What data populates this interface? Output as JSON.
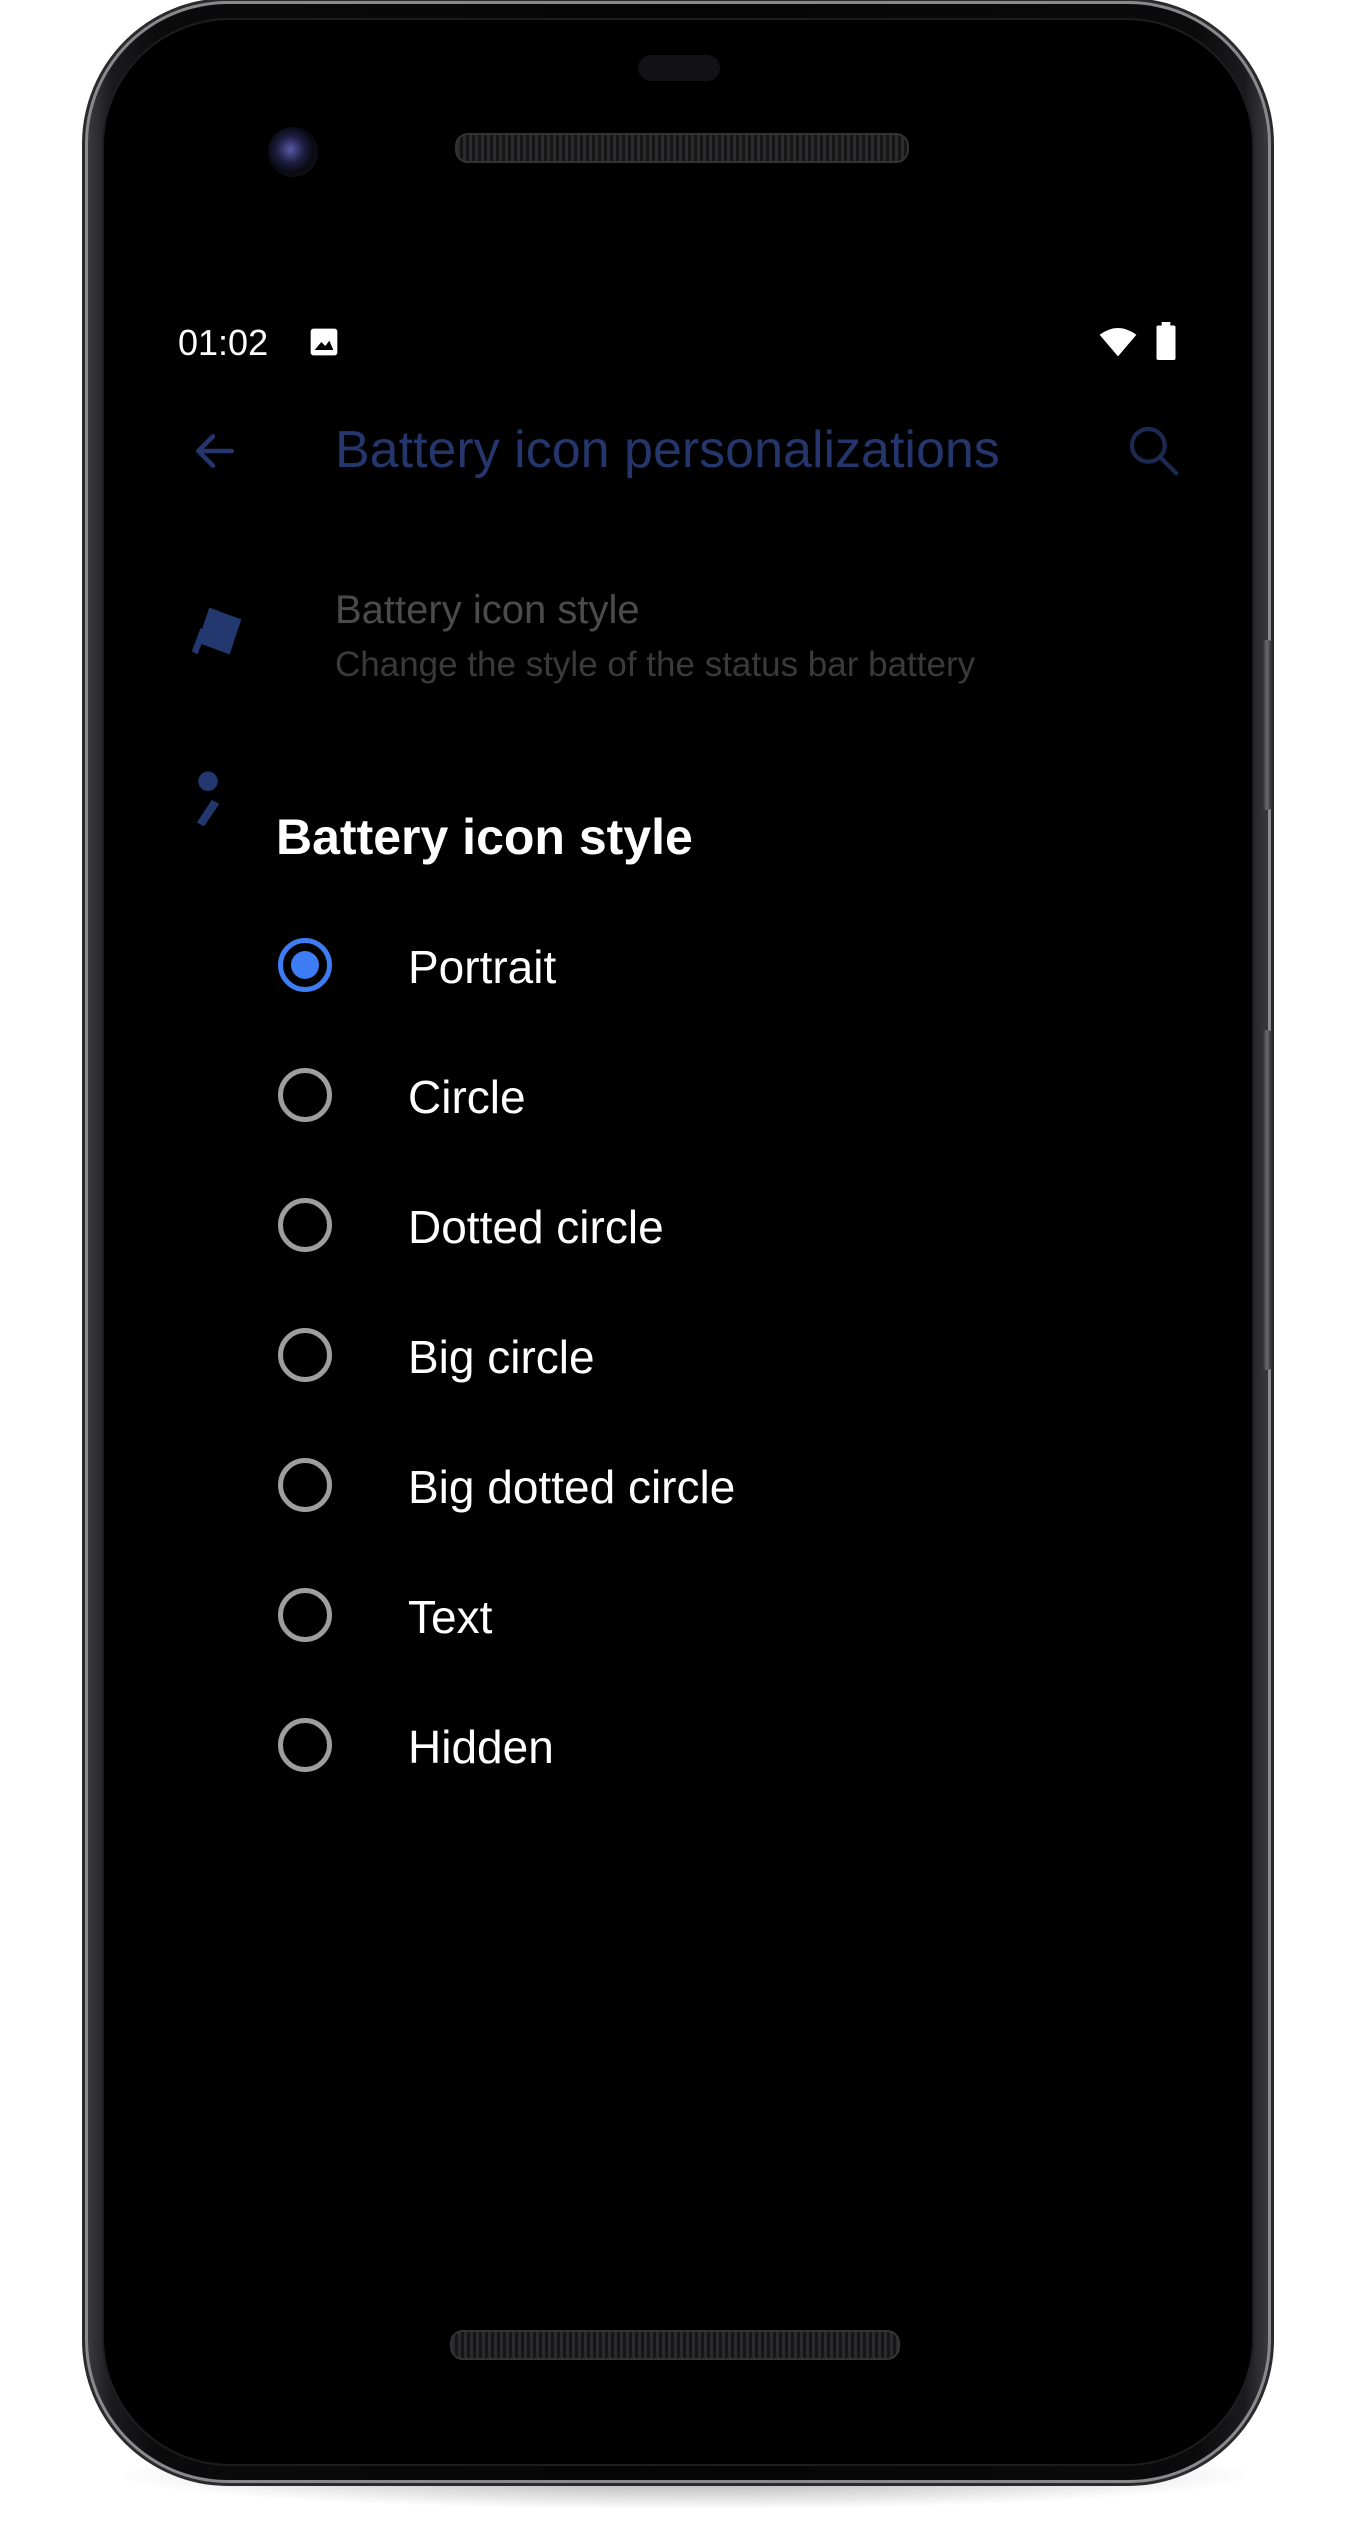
{
  "status_bar": {
    "time": "01:02",
    "icons": [
      "image-icon",
      "wifi-icon",
      "battery-icon"
    ]
  },
  "app_bar": {
    "title": "Battery icon personalizations",
    "back_icon": "arrow-back-icon",
    "search_icon": "search-icon"
  },
  "preferences": [
    {
      "title": "Battery icon style",
      "summary": "Change the style of the status bar battery",
      "icon": "battery-style-icon"
    }
  ],
  "dialog": {
    "title": "Battery icon style",
    "options": [
      {
        "label": "Portrait",
        "checked": true
      },
      {
        "label": "Circle",
        "checked": false
      },
      {
        "label": "Dotted circle",
        "checked": false
      },
      {
        "label": "Big circle",
        "checked": false
      },
      {
        "label": "Big dotted circle",
        "checked": false
      },
      {
        "label": "Text",
        "checked": false
      },
      {
        "label": "Hidden",
        "checked": false
      }
    ]
  },
  "colors": {
    "accent": "#3d7cf2",
    "dim_title": "#24366b",
    "background": "#000000",
    "radio_unchecked": "#9e9e9e"
  }
}
